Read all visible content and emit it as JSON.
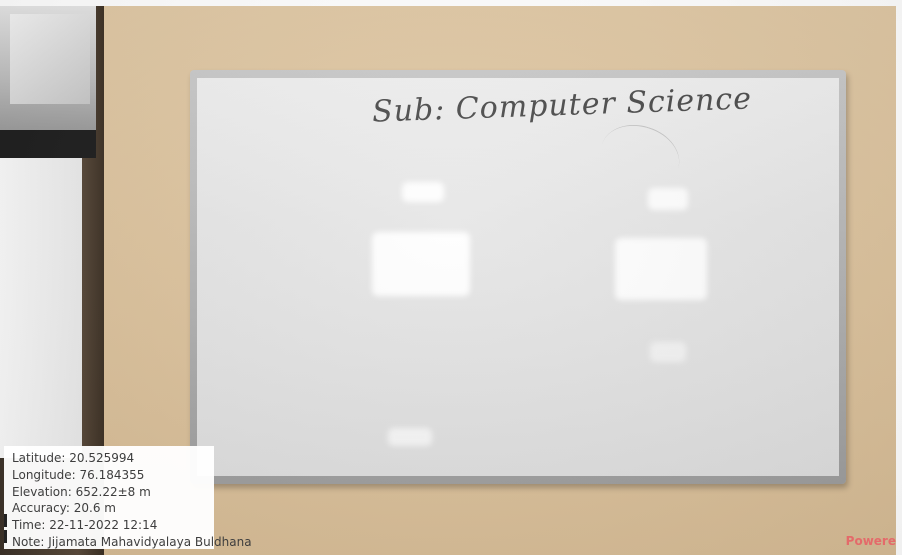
{
  "board": {
    "heading": "Sub: Computer Science"
  },
  "geotag": {
    "latitude": "Latitude: 20.525994",
    "longitude": "Longitude: 76.184355",
    "elevation": "Elevation: 652.22±8 m",
    "accuracy": "Accuracy: 20.6 m",
    "time": "Time: 22-11-2022 12:14",
    "note": "Note: Jijamata Mahavidyalaya Buldhana"
  },
  "watermark": "Powere"
}
